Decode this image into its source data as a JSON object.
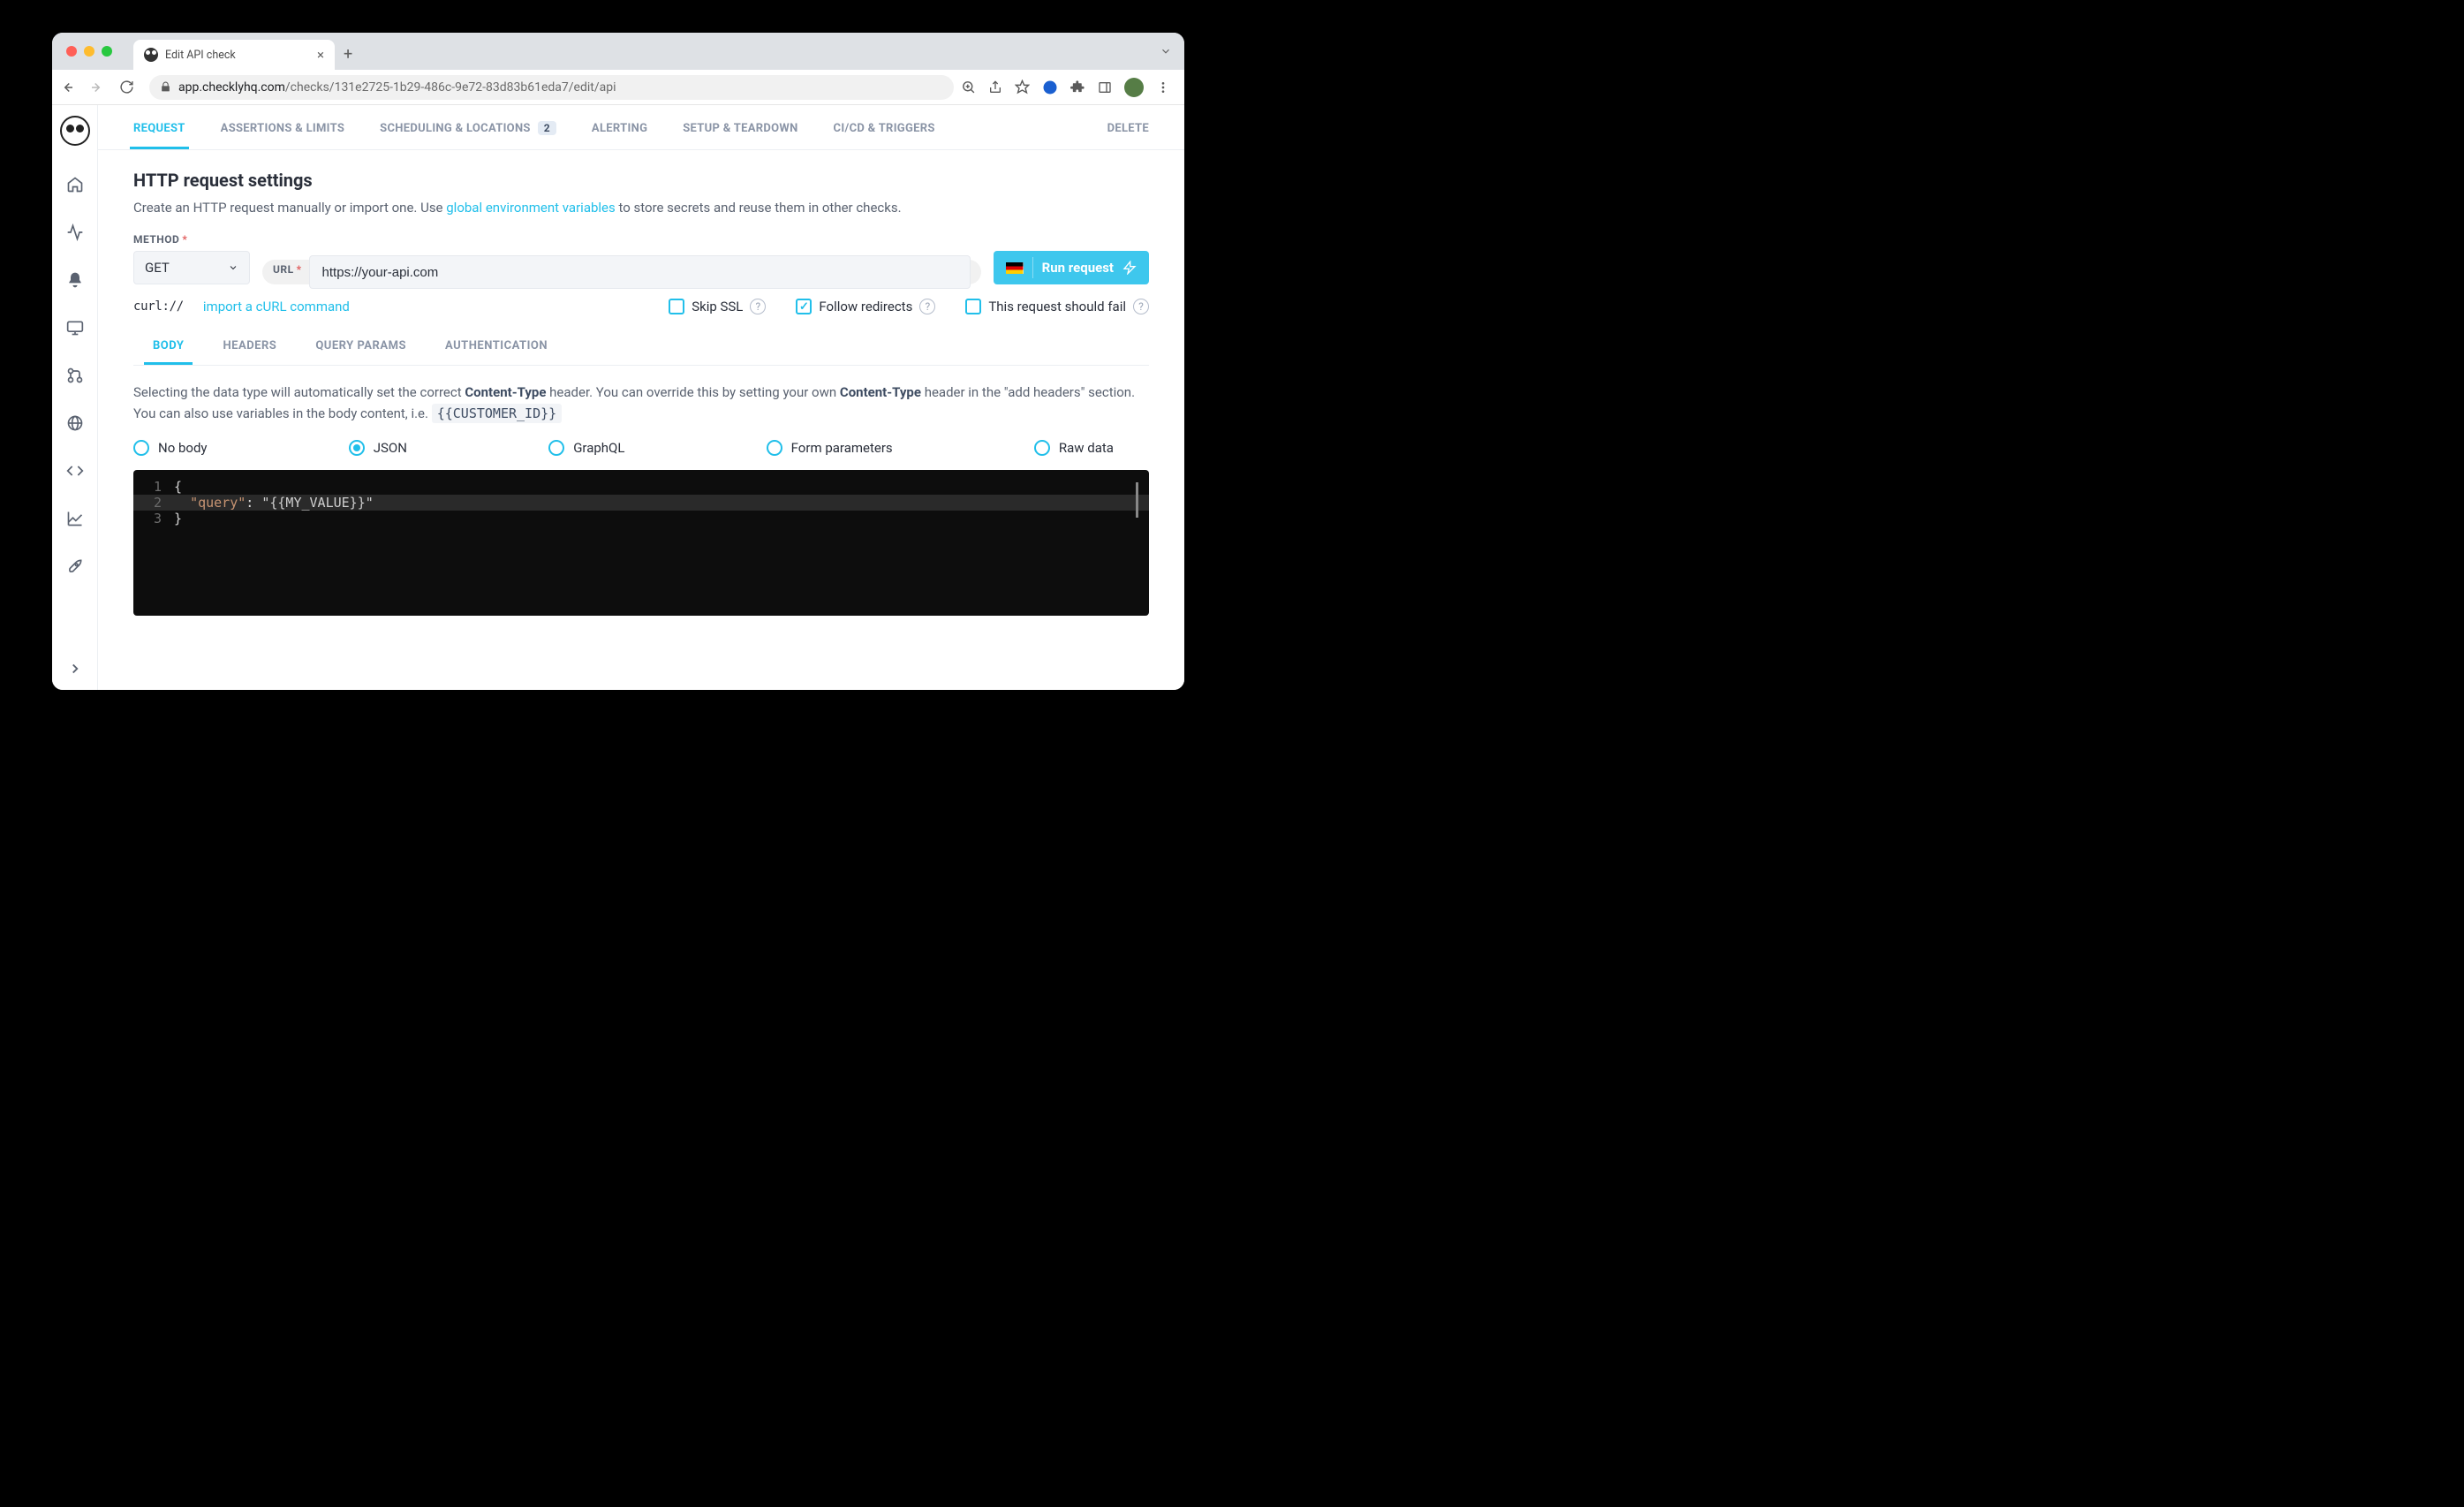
{
  "browser": {
    "tab_title": "Edit API check",
    "url_host": "app.checklyhq.com",
    "url_path": "/checks/131e2725-1b29-486c-9e72-83d83b61eda7/edit/api"
  },
  "topnav": {
    "tabs": [
      {
        "label": "REQUEST"
      },
      {
        "label": "ASSERTIONS & LIMITS"
      },
      {
        "label": "SCHEDULING & LOCATIONS",
        "badge": "2"
      },
      {
        "label": "ALERTING"
      },
      {
        "label": "SETUP & TEARDOWN"
      },
      {
        "label": "CI/CD & TRIGGERS"
      },
      {
        "label": "DELETE"
      }
    ]
  },
  "section": {
    "title": "HTTP request settings",
    "desc_pre": "Create an HTTP request manually or import one. Use ",
    "desc_link": "global environment variables",
    "desc_post": " to store secrets and reuse them in other checks."
  },
  "form": {
    "method_label": "METHOD",
    "url_label": "URL",
    "method_value": "GET",
    "url_value": "https://your-api.com",
    "run_label": "Run request"
  },
  "options": {
    "curl_label": "curl://",
    "import_label": "import a cURL command",
    "skip_ssl_label": "Skip SSL",
    "follow_redirects_label": "Follow redirects",
    "should_fail_label": "This request should fail"
  },
  "subtabs": [
    {
      "label": "BODY"
    },
    {
      "label": "HEADERS"
    },
    {
      "label": "QUERY PARAMS"
    },
    {
      "label": "AUTHENTICATION"
    }
  ],
  "body": {
    "desc_1": "Selecting the data type will automatically set the correct ",
    "desc_ct": "Content-Type",
    "desc_2": " header. You can override this by setting your own ",
    "desc_3": " header in the \"add headers\" section. You can also use variables in the body content, i.e. ",
    "desc_code": "{{CUSTOMER_ID}}",
    "radios": [
      "No body",
      "JSON",
      "GraphQL",
      "Form parameters",
      "Raw data"
    ]
  },
  "editor": {
    "lines": [
      "{",
      "  \"query\": \"{{MY_VALUE}}\"",
      "}"
    ]
  }
}
